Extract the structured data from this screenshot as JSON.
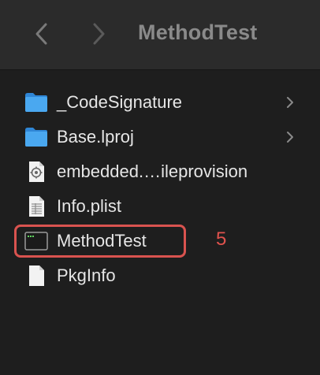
{
  "window": {
    "title": "MethodTest"
  },
  "toolbar": {
    "back_icon": "chevron-left-icon",
    "forward_icon": "chevron-right-icon"
  },
  "files": [
    {
      "label": "_CodeSignature",
      "icon": "folder-icon",
      "expandable": true
    },
    {
      "label": "Base.lproj",
      "icon": "folder-icon",
      "expandable": true
    },
    {
      "label": "embedded.…ileprovision",
      "icon": "provisioning-profile-icon",
      "expandable": false
    },
    {
      "label": "Info.plist",
      "icon": "plist-document-icon",
      "expandable": false
    },
    {
      "label": "MethodTest",
      "icon": "terminal-executable-icon",
      "expandable": false
    },
    {
      "label": "PkgInfo",
      "icon": "blank-document-icon",
      "expandable": false
    }
  ],
  "annotation": {
    "number": "5",
    "color": "#d9534f"
  },
  "colors": {
    "background": "#1e1e1e",
    "toolbar": "#2b2b2b",
    "folder": "#3d9be9",
    "text": "#e6e6e6"
  }
}
